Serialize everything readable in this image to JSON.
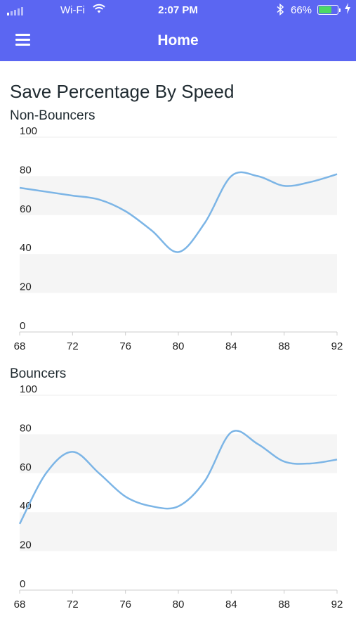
{
  "status_bar": {
    "carrier": "Wi-Fi",
    "time": "2:07 PM",
    "battery": "66%",
    "battery_level": 0.66
  },
  "nav": {
    "title": "Home"
  },
  "page": {
    "title": "Save Percentage By Speed"
  },
  "colors": {
    "accent": "#5b66f2",
    "line": "#7cb5e6",
    "band": "#f5f5f5"
  },
  "chart_data": [
    {
      "type": "line",
      "title": "Non-Bouncers",
      "x": [
        68,
        70,
        72,
        74,
        76,
        78,
        80,
        82,
        84,
        86,
        88,
        90,
        92
      ],
      "y": [
        74,
        72,
        70,
        68,
        62,
        52,
        41,
        56,
        80,
        80,
        75,
        77,
        81
      ],
      "xticks": [
        68,
        72,
        76,
        80,
        84,
        88,
        92
      ],
      "yticks": [
        0,
        20,
        40,
        60,
        80,
        100
      ],
      "xlim": [
        68,
        92
      ],
      "ylim": [
        0,
        100
      ],
      "grid": "alternating-bands"
    },
    {
      "type": "line",
      "title": "Bouncers",
      "x": [
        68,
        70,
        72,
        74,
        76,
        78,
        80,
        82,
        84,
        86,
        88,
        90,
        92
      ],
      "y": [
        34,
        60,
        71,
        60,
        48,
        43,
        43,
        56,
        81,
        75,
        66,
        65,
        67
      ],
      "xticks": [
        68,
        72,
        76,
        80,
        84,
        88,
        92
      ],
      "yticks": [
        0,
        20,
        40,
        60,
        80,
        100
      ],
      "xlim": [
        68,
        92
      ],
      "ylim": [
        0,
        100
      ],
      "grid": "alternating-bands"
    }
  ]
}
